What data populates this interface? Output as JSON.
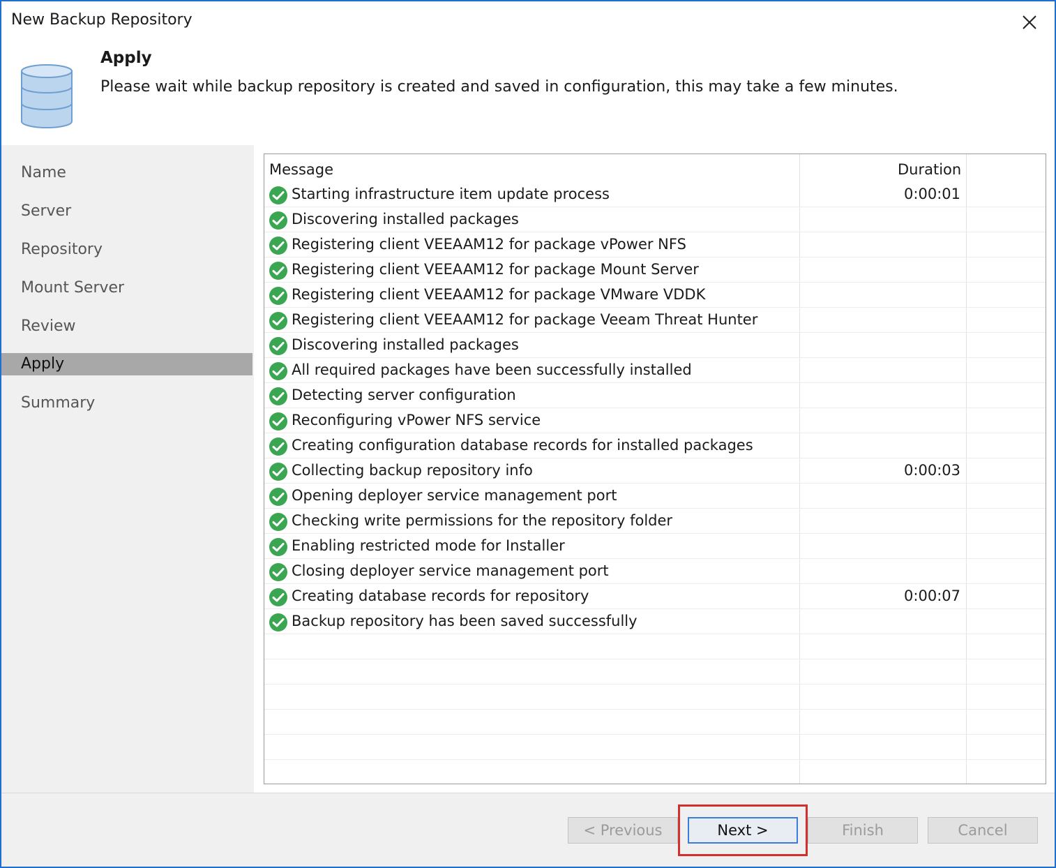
{
  "window": {
    "title": "New Backup Repository"
  },
  "header": {
    "step_title": "Apply",
    "description": "Please wait while backup repository is created and saved in configuration, this may take a few minutes."
  },
  "sidebar": {
    "items": [
      {
        "label": "Name"
      },
      {
        "label": "Server"
      },
      {
        "label": "Repository"
      },
      {
        "label": "Mount Server"
      },
      {
        "label": "Review"
      },
      {
        "label": "Apply",
        "active": true
      },
      {
        "label": "Summary"
      }
    ]
  },
  "log": {
    "columns": {
      "message": "Message",
      "duration": "Duration"
    },
    "rows": [
      {
        "status": "success",
        "message": "Starting infrastructure item update process",
        "duration": "0:00:01"
      },
      {
        "status": "success",
        "message": "Discovering installed packages",
        "duration": ""
      },
      {
        "status": "success",
        "message": "Registering client VEEAAM12 for package vPower NFS",
        "duration": ""
      },
      {
        "status": "success",
        "message": "Registering client VEEAAM12 for package Mount Server",
        "duration": ""
      },
      {
        "status": "success",
        "message": "Registering client VEEAAM12 for package VMware VDDK",
        "duration": ""
      },
      {
        "status": "success",
        "message": "Registering client VEEAAM12 for package Veeam Threat Hunter",
        "duration": ""
      },
      {
        "status": "success",
        "message": "Discovering installed packages",
        "duration": ""
      },
      {
        "status": "success",
        "message": "All required packages have been successfully installed",
        "duration": ""
      },
      {
        "status": "success",
        "message": "Detecting server configuration",
        "duration": ""
      },
      {
        "status": "success",
        "message": "Reconfiguring vPower NFS service",
        "duration": ""
      },
      {
        "status": "success",
        "message": "Creating configuration database records for installed packages",
        "duration": ""
      },
      {
        "status": "success",
        "message": "Collecting backup repository info",
        "duration": "0:00:03"
      },
      {
        "status": "success",
        "message": "Opening deployer service management port",
        "duration": ""
      },
      {
        "status": "success",
        "message": "Checking write permissions for the repository folder",
        "duration": ""
      },
      {
        "status": "success",
        "message": "Enabling restricted mode for Installer",
        "duration": ""
      },
      {
        "status": "success",
        "message": "Closing deployer service management port",
        "duration": ""
      },
      {
        "status": "success",
        "message": "Creating database records for repository",
        "duration": "0:00:07"
      },
      {
        "status": "success",
        "message": "Backup repository has been saved successfully",
        "duration": ""
      },
      {
        "status": "empty",
        "message": "",
        "duration": ""
      },
      {
        "status": "empty",
        "message": "",
        "duration": ""
      },
      {
        "status": "empty",
        "message": "",
        "duration": ""
      },
      {
        "status": "empty",
        "message": "",
        "duration": ""
      },
      {
        "status": "empty",
        "message": "",
        "duration": ""
      },
      {
        "status": "empty",
        "message": "",
        "duration": ""
      }
    ]
  },
  "footer": {
    "previous_label": "< Previous",
    "next_label": "Next >",
    "finish_label": "Finish",
    "cancel_label": "Cancel"
  },
  "colors": {
    "window_border": "#1e6fd0",
    "active_step": "#a8a8a8",
    "success": "#3aa652",
    "highlight": "#d32f2f"
  },
  "icons": {
    "header": "database-icon",
    "row_status": "check-circle-icon",
    "close": "close-icon"
  }
}
